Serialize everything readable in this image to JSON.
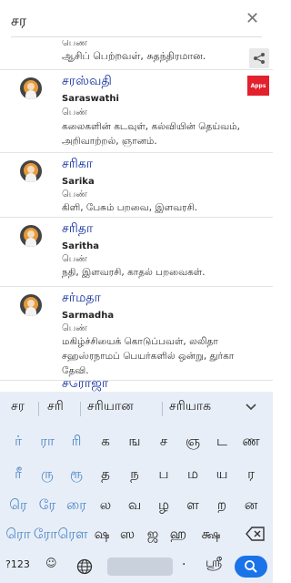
{
  "search": {
    "value": "சர",
    "close_icon": "close-icon"
  },
  "partial_item": {
    "gender": "பெண்",
    "meaning": "ஆசிப் பெற்றவள், சுதந்திரமான."
  },
  "items": [
    {
      "name_ta": "சரஸ்வதி",
      "name_en": "Saraswathi",
      "gender": "பெண்",
      "meaning": "கலைகளின் கடவுள், கல்வியின் தெய்வம், அறிவாற்றல், ஞானம்.",
      "badge": "Apps"
    },
    {
      "name_ta": "சரிகா",
      "name_en": "Sarika",
      "gender": "பெண்",
      "meaning": "கிளி, பேசும் பறவை, இளவரசி."
    },
    {
      "name_ta": "சரிதா",
      "name_en": "Saritha",
      "gender": "பெண்",
      "meaning": "நதி, இளவரசி, காதல் பறவைகள்."
    },
    {
      "name_ta": "சர்மதா",
      "name_en": "Sarmadha",
      "gender": "பெண்",
      "meaning": "மகிழ்ச்சியைக் கொடுப்பவள், லலிதா சஹஸ்ரநாமப் பெயர்களில் ஒன்று, துர்கா தேவி."
    },
    {
      "name_ta": "சரோஜா"
    }
  ],
  "keyboard": {
    "suggestions": [
      "சர",
      "சரி",
      "சரியான",
      "சரியாக"
    ],
    "row1": [
      "ர்",
      "ரா",
      "ரி",
      "க",
      "ங",
      "ச",
      "ஞ",
      "ட",
      "ண"
    ],
    "row2": [
      "ரீ",
      "ரு",
      "ரூ",
      "த",
      "ந",
      "ப",
      "ம",
      "ய",
      "ர"
    ],
    "row3": [
      "ரெ",
      "ரே",
      "ரை",
      "ல",
      "வ",
      "ழ",
      "ள",
      "ற",
      "ன"
    ],
    "row4": [
      "ரொ",
      "ரோ",
      "ரௌ",
      "ஷ",
      "ஸ",
      "ஜ",
      "ஹ",
      "க்ஷ"
    ],
    "k123": "?123",
    "period": ".",
    "shri": "ஸ்ரீ"
  },
  "colors": {
    "accent": "#1a73e8",
    "vowel_keys": "#4a86c8",
    "name_tamil": "#0a2a9a",
    "apps_badge": "#e3202d"
  }
}
